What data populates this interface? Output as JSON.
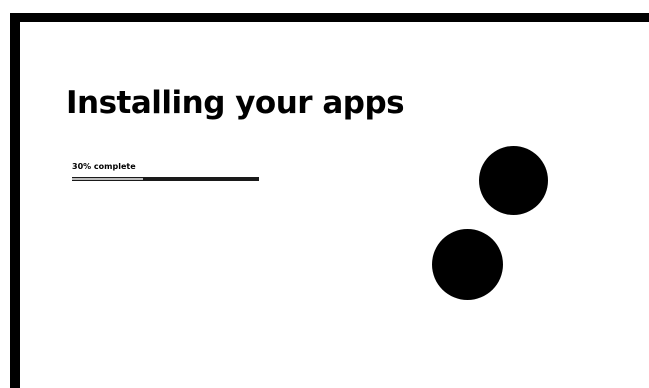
{
  "installer": {
    "title": "Installing your apps",
    "progress": {
      "label": "30% complete",
      "fraction": 0.38
    }
  },
  "colors": {
    "background": "#ffffff",
    "frame": "#000000",
    "text": "#000000",
    "progress_track": "#1a1a1a",
    "progress_fill": "#bdbdbd",
    "spinner_dots": "#000000"
  },
  "icons": {
    "spinner": "loading-spinner-icon"
  }
}
